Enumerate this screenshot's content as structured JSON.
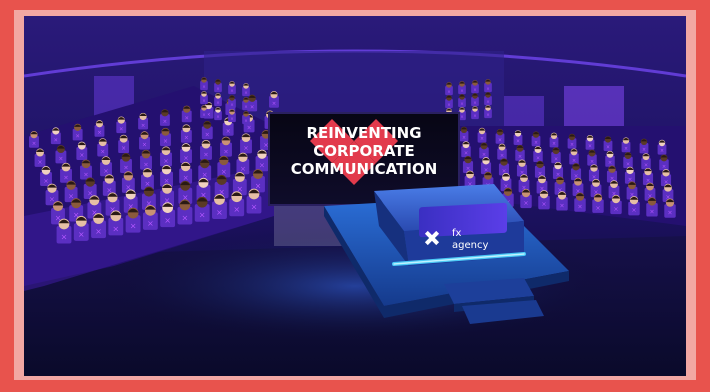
{
  "frame": {
    "outer_color": "#e8534d",
    "inner_color": "#f2a7a3"
  },
  "screen": {
    "line1": "REINVENTING",
    "line2": "CORPORATE",
    "line3": "COMMUNICATION",
    "accent": "#e23a4c"
  },
  "podium": {
    "brand_top": "fx",
    "brand_bottom": "agency",
    "logo_icon": "x-cross-icon",
    "panel_color": "#4a3bd6",
    "glow_color": "#4fd8ff"
  },
  "scene": {
    "background": "#1a0f4a",
    "seat_color": "#5b2fc2",
    "seat_x_color": "#b256ff"
  }
}
